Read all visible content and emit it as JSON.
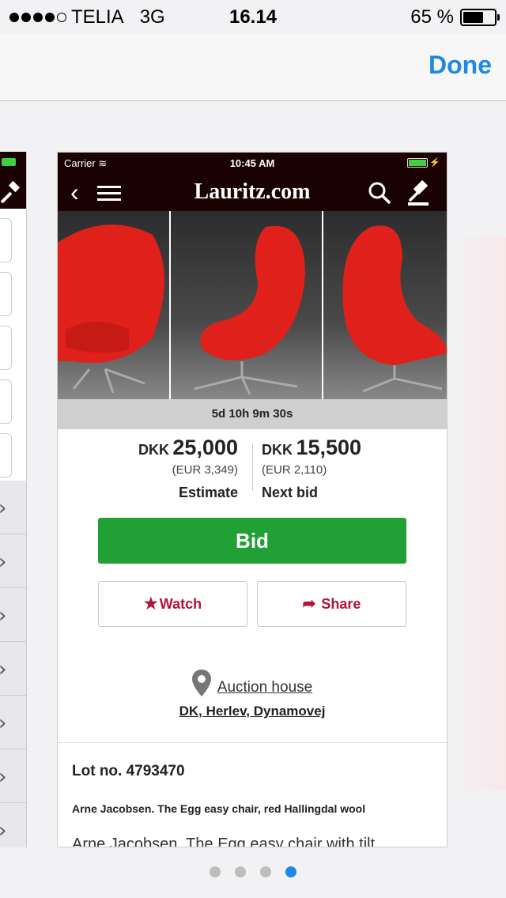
{
  "os_status": {
    "carrier": "TELIA",
    "network": "3G",
    "time": "16.14",
    "battery_text": "65 %",
    "battery_level": 0.65
  },
  "top_bar": {
    "done_label": "Done"
  },
  "app": {
    "status": {
      "carrier": "Carrier",
      "time": "10:45 AM"
    },
    "logo": "Lauritz.com",
    "timer": "5d 10h 9m 30s",
    "estimate": {
      "currency": "DKK",
      "amount": "25,000",
      "eur": "(EUR 3,349)",
      "label": "Estimate"
    },
    "next_bid": {
      "currency": "DKK",
      "amount": "15,500",
      "eur": "(EUR 2,110)",
      "label": "Next bid"
    },
    "bid_label": "Bid",
    "watch_label": "Watch",
    "share_label": "Share",
    "auction_house_label": "Auction house",
    "address": "DK, Herlev, Dynamovej",
    "lot_no": "Lot no. 4793470",
    "lot_title": "Arne Jacobsen. The Egg easy chair, red Hallingdal wool",
    "lot_desc": "Arne Jacobsen. The Egg easy chair with tilt"
  },
  "colors": {
    "accent": "#1e88e5",
    "bid_green": "#21a035",
    "brand_red": "#b3123a",
    "header_dark": "#1a0202"
  },
  "pager": {
    "count": 4,
    "active_index": 3
  }
}
